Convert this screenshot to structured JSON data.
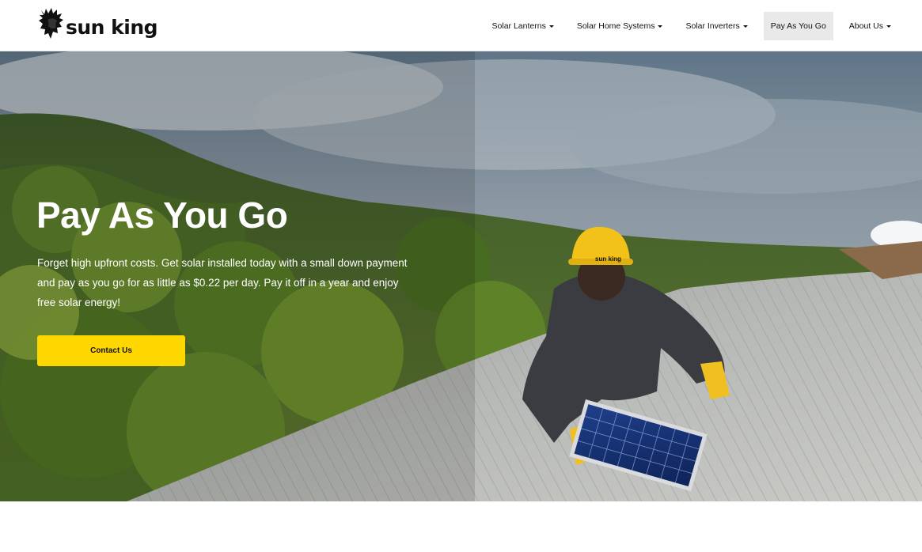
{
  "brand": {
    "name": "sun king",
    "logo_icon": "lion-head-icon"
  },
  "nav": {
    "items": [
      {
        "label": "Solar Lanterns",
        "dropdown": true
      },
      {
        "label": "Solar Home Systems",
        "dropdown": true
      },
      {
        "label": "Solar Inverters",
        "dropdown": true
      },
      {
        "label": "Pay As You Go",
        "dropdown": false,
        "active": true
      },
      {
        "label": "About Us",
        "dropdown": true
      }
    ]
  },
  "hero": {
    "title": "Pay As You Go",
    "description": "Forget high upfront costs. Get solar installed today with a small down payment and pay as you go for as little as $0.22 per day. Pay it off in a year and enjoy free solar energy!",
    "cta_label": "Contact Us",
    "helmet_text": "sun king"
  },
  "colors": {
    "accent": "#ffd700",
    "active_nav_bg": "#e9e9e9",
    "text_dark": "#111111",
    "hero_text": "#ffffff"
  }
}
